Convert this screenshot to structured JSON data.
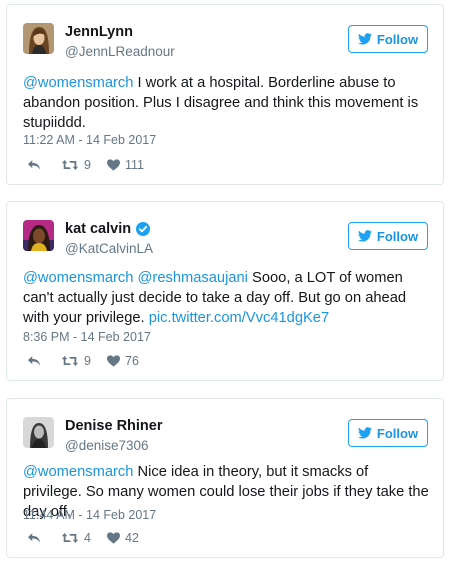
{
  "colors": {
    "link": "#1b95e0",
    "text": "#14171a",
    "muted": "#657786",
    "border": "#e1e8ed",
    "verified": "#1da1f2"
  },
  "tweets": [
    {
      "name": "JennLynn",
      "handle": "@JennLReadnour",
      "verified": false,
      "follow_label": "Follow",
      "text_segments": [
        {
          "text": "@womensmarch",
          "link": true
        },
        {
          "text": " I work at a hospital. Borderline abuse to abandon position. Plus I disagree and think this movement is stupiiddd.",
          "link": false
        }
      ],
      "timestamp": "11:22 AM - 14 Feb 2017",
      "retweets": "9",
      "likes": "111",
      "icons": {
        "reply": "reply-icon",
        "retweet": "retweet-icon",
        "like": "heart-icon",
        "follow": "twitter-bird-icon"
      }
    },
    {
      "name": "kat calvin",
      "handle": "@KatCalvinLA",
      "verified": true,
      "follow_label": "Follow",
      "text_segments": [
        {
          "text": "@womensmarch",
          "link": true
        },
        {
          "text": " ",
          "link": false
        },
        {
          "text": "@reshmasaujani",
          "link": true
        },
        {
          "text": " Sooo, a LOT of women can't actually just decide to take a day off. But go on ahead with your privilege. ",
          "link": false
        },
        {
          "text": "pic.twitter.com/Vvc41dgKe7",
          "link": true
        }
      ],
      "timestamp": "8:36 PM - 14 Feb 2017",
      "retweets": "9",
      "likes": "76",
      "icons": {
        "reply": "reply-icon",
        "retweet": "retweet-icon",
        "like": "heart-icon",
        "follow": "twitter-bird-icon"
      }
    },
    {
      "name": "Denise Rhiner",
      "handle": "@denise7306",
      "verified": false,
      "follow_label": "Follow",
      "text_segments": [
        {
          "text": "@womensmarch",
          "link": true
        },
        {
          "text": " Nice idea in theory, but it smacks of privilege. So many women could lose their jobs if they take the day off.",
          "link": false
        }
      ],
      "timestamp": "11:44 AM - 14 Feb 2017",
      "retweets": "4",
      "likes": "42",
      "icons": {
        "reply": "reply-icon",
        "retweet": "retweet-icon",
        "like": "heart-icon",
        "follow": "twitter-bird-icon"
      }
    }
  ]
}
